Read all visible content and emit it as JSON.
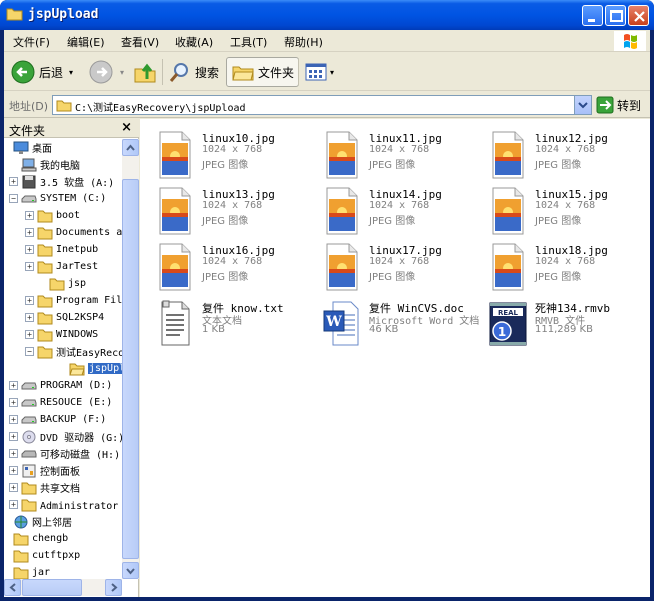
{
  "window": {
    "title": "jspUpload"
  },
  "menu": [
    "文件(F)",
    "编辑(E)",
    "查看(V)",
    "收藏(A)",
    "工具(T)",
    "帮助(H)"
  ],
  "toolbar": {
    "back_label": "后退",
    "search_label": "搜索",
    "folders_label": "文件夹"
  },
  "address": {
    "label": "地址(D)",
    "path": "C:\\测试EasyRecovery\\jspUpload",
    "go_label": "转到"
  },
  "folder_pane": {
    "title": "文件夹",
    "close": "×",
    "items": [
      {
        "label": "桌面"
      },
      {
        "label": "我的电脑"
      },
      {
        "label": "3.5 软盘 (A:)"
      },
      {
        "label": "SYSTEM (C:)"
      },
      {
        "label": "boot"
      },
      {
        "label": "Documents ar"
      },
      {
        "label": "Inetpub"
      },
      {
        "label": "JarTest"
      },
      {
        "label": "jsp"
      },
      {
        "label": "Program File"
      },
      {
        "label": "SQL2KSP4"
      },
      {
        "label": "WINDOWS"
      },
      {
        "label": "测试EasyReco"
      },
      {
        "label": "jspUpload"
      },
      {
        "label": "PROGRAM (D:)"
      },
      {
        "label": "RESOUCE (E:)"
      },
      {
        "label": "BACKUP (F:)"
      },
      {
        "label": "DVD 驱动器 (G:)"
      },
      {
        "label": "可移动磁盘 (H:)"
      },
      {
        "label": "控制面板"
      },
      {
        "label": "共享文档"
      },
      {
        "label": "Administrator 的"
      },
      {
        "label": "网上邻居"
      },
      {
        "label": "chengb"
      },
      {
        "label": "cutftpxp"
      },
      {
        "label": "jar"
      }
    ]
  },
  "files": [
    {
      "name": "linux10.jpg",
      "line2": "1024 x 768",
      "line3": "JPEG 图像",
      "icon": "jpeg-icon"
    },
    {
      "name": "linux11.jpg",
      "line2": "1024 x 768",
      "line3": "JPEG 图像",
      "icon": "jpeg-icon"
    },
    {
      "name": "linux12.jpg",
      "line2": "1024 x 768",
      "line3": "JPEG 图像",
      "icon": "jpeg-icon"
    },
    {
      "name": "linux13.jpg",
      "line2": "1024 x 768",
      "line3": "JPEG 图像",
      "icon": "jpeg-icon"
    },
    {
      "name": "linux14.jpg",
      "line2": "1024 x 768",
      "line3": "JPEG 图像",
      "icon": "jpeg-icon"
    },
    {
      "name": "linux15.jpg",
      "line2": "1024 x 768",
      "line3": "JPEG 图像",
      "icon": "jpeg-icon"
    },
    {
      "name": "linux16.jpg",
      "line2": "1024 x 768",
      "line3": "JPEG 图像",
      "icon": "jpeg-icon"
    },
    {
      "name": "linux17.jpg",
      "line2": "1024 x 768",
      "line3": "JPEG 图像",
      "icon": "jpeg-icon"
    },
    {
      "name": "linux18.jpg",
      "line2": "1024 x 768",
      "line3": "JPEG 图像",
      "icon": "jpeg-icon"
    },
    {
      "name": "复件 know.txt",
      "line2": "文本文档",
      "line3": "1 KB",
      "icon": "text-document-icon"
    },
    {
      "name": "复件 WinCVS.doc",
      "line2": "Microsoft Word 文档",
      "line3": "46 KB",
      "icon": "word-document-icon"
    },
    {
      "name": "死神134.rmvb",
      "line2": "RMVB 文件",
      "line3": "111,289 KB",
      "icon": "realplayer-icon"
    }
  ],
  "colors": {
    "titlebar": "#0054e3",
    "selection": "#316ac5",
    "frame": "#ece9d8"
  }
}
